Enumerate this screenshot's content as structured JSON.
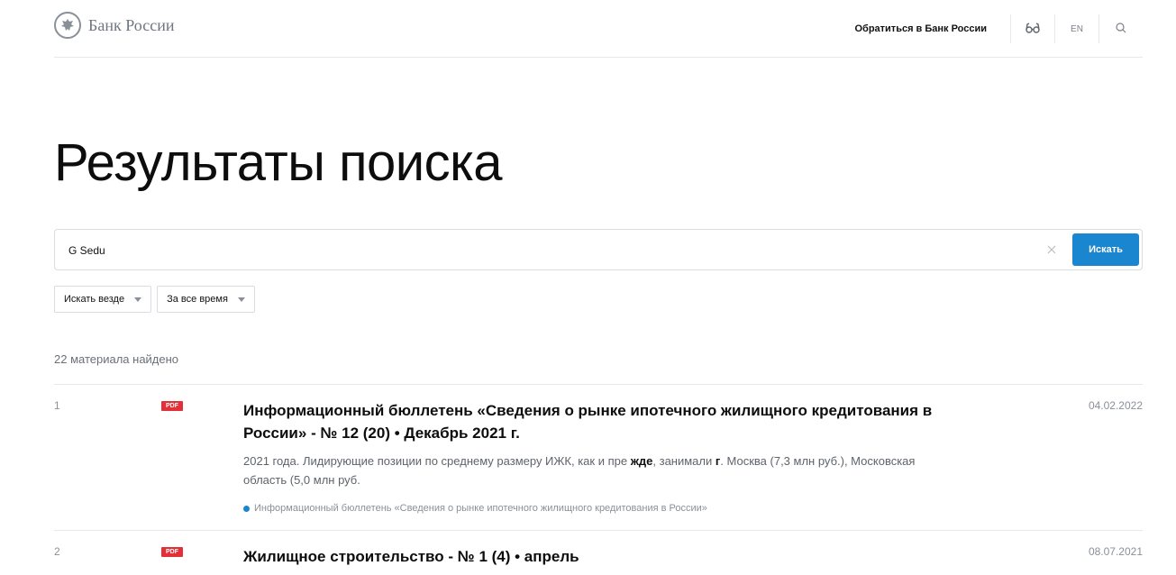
{
  "header": {
    "logo_text": "Банк России",
    "contact_label": "Обратиться в Банк России",
    "lang_label": "EN"
  },
  "page": {
    "title": "Результаты поиска"
  },
  "search": {
    "query": "G Sedu",
    "button_label": "Искать"
  },
  "filters": {
    "scope": "Искать везде",
    "period": "За все время"
  },
  "results_summary": "22 материала найдено",
  "results": [
    {
      "number": "1",
      "badge": "PDF",
      "title": "Информационный бюллетень «Сведения о рынке ипотечного жилищного кредитования в России» - № 12 (20) • Декабрь 2021 г.",
      "date": "04.02.2022",
      "snippet_parts": [
        "2021 года. Лидирующие позиции по среднему размеру ИЖК, как и пре ",
        "жде",
        ", занимали ",
        "г",
        ". Москва (7,3 млн руб.), Московская область (5,0 млн руб."
      ],
      "source": "Информационный бюллетень «Сведения о рынке ипотечного жилищного кредитования в России»"
    },
    {
      "number": "2",
      "badge": "PDF",
      "title": "Жилищное строительство - № 1 (4) • апрель",
      "date": "08.07.2021"
    }
  ],
  "colors": {
    "accent": "#1a86cf",
    "pdf_badge": "#e32f37",
    "muted_text": "#8a9099"
  },
  "icons": {
    "logo": "eagle-emblem-icon",
    "accessibility": "glasses-icon",
    "search": "search-icon",
    "clear": "close-icon",
    "dropdown": "caret-down-icon",
    "source_marker": "dot-icon"
  }
}
